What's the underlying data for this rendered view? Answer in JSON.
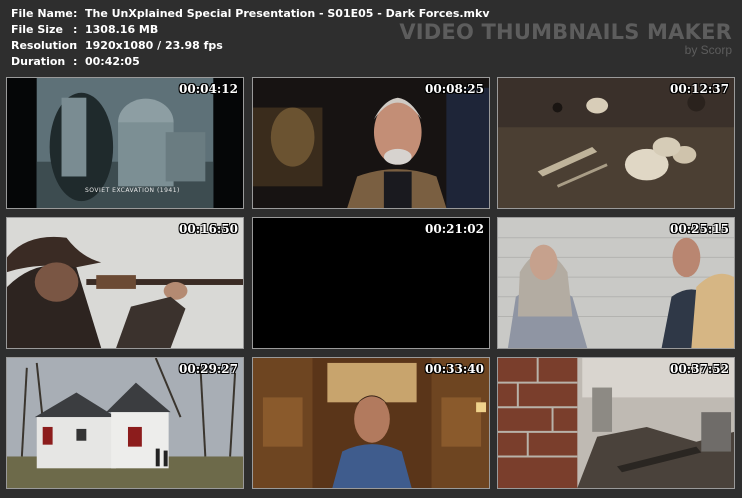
{
  "file_info": {
    "name_label": "File Name",
    "name_value": "The UnXplained Special Presentation - S01E05 - Dark Forces.mkv",
    "size_label": "File Size",
    "size_value": "1308.16 MB",
    "resolution_label": "Resolution",
    "resolution_value": "1920x1080 / 23.98 fps",
    "duration_label": "Duration",
    "duration_value": "00:42:05",
    "separator": ":"
  },
  "watermark": {
    "title": "VIDEO THUMBNAILS MAKER",
    "subtitle": "by Scorp"
  },
  "thumbnails": [
    {
      "timestamp": "00:04:12",
      "caption": "SOVIET EXCAVATION (1941)",
      "icon": "cathedral-scene"
    },
    {
      "timestamp": "00:08:25",
      "icon": "interview-older-man"
    },
    {
      "timestamp": "00:12:37",
      "icon": "excavated-bones"
    },
    {
      "timestamp": "00:16:50",
      "icon": "rifle-shooter"
    },
    {
      "timestamp": "00:21:02",
      "icon": "black-frame"
    },
    {
      "timestamp": "00:25:15",
      "icon": "woman-and-man-outdoors"
    },
    {
      "timestamp": "00:29:27",
      "icon": "white-farmhouse"
    },
    {
      "timestamp": "00:33:40",
      "icon": "interview-man-blue-shirt"
    },
    {
      "timestamp": "00:37:52",
      "icon": "burned-ruins"
    }
  ],
  "colors": {
    "background": "#2e2e2e",
    "watermark": "#5d5d5d",
    "thumb_border": "#9a9a9a"
  }
}
